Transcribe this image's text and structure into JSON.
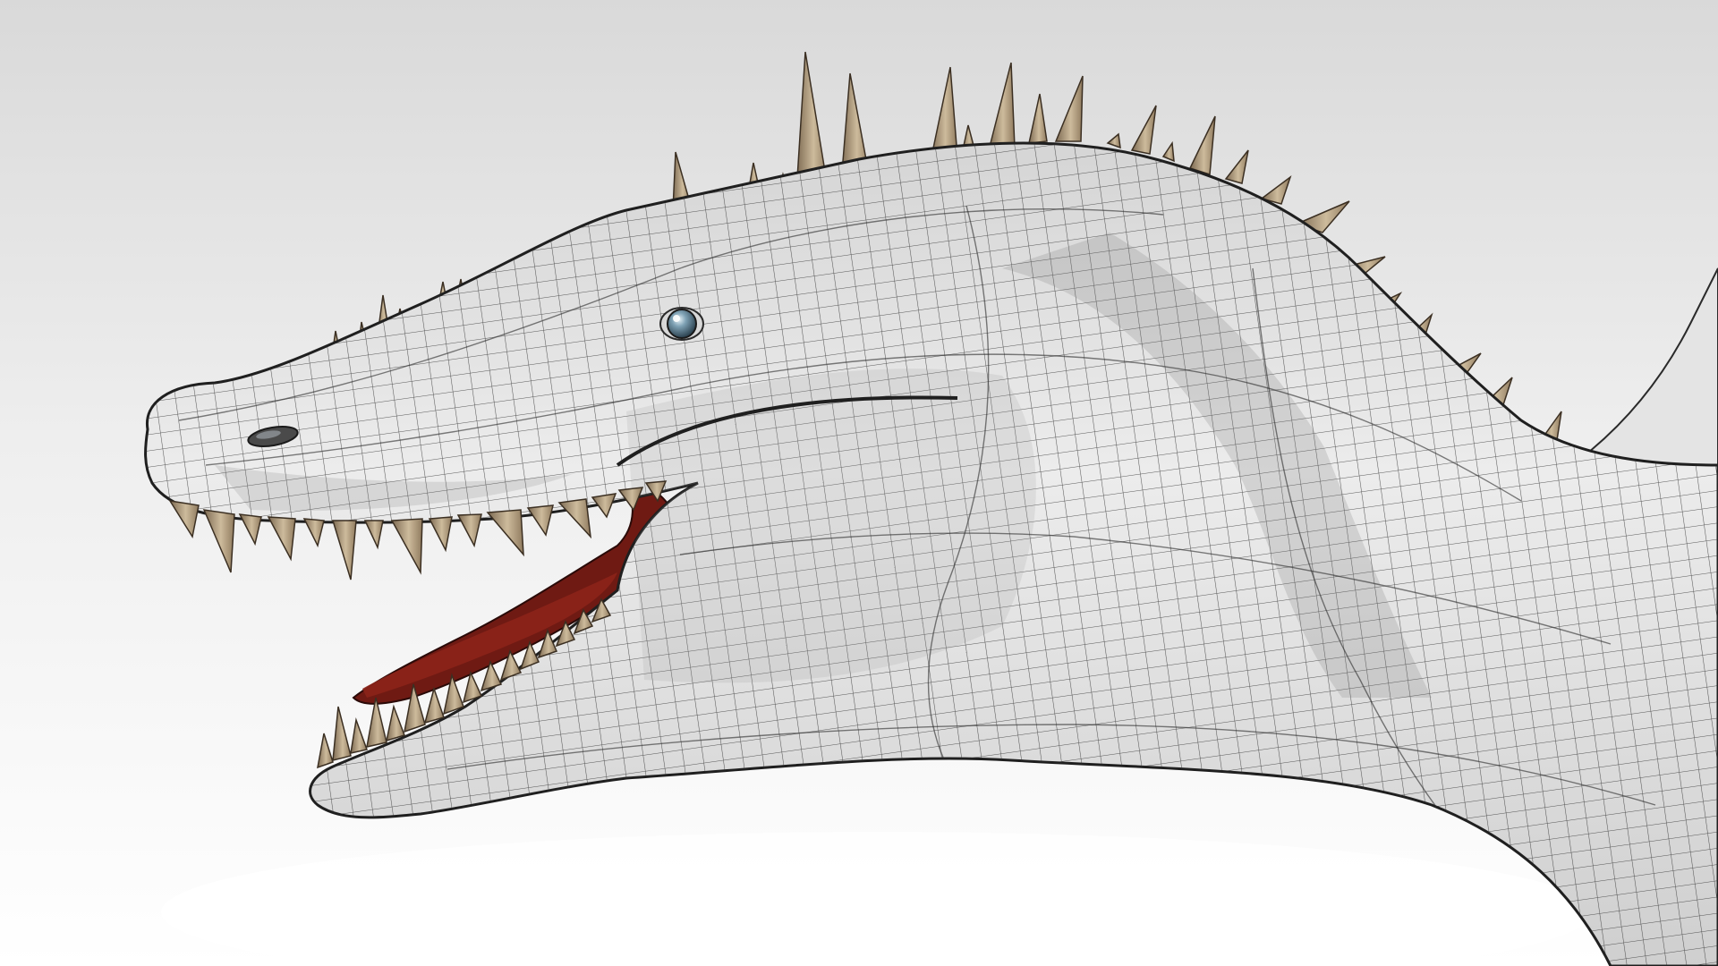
{
  "scene": {
    "subject": "dinosaur-head-wireframe-render",
    "colors": {
      "background_top": "#dcdcdc",
      "background_bottom": "#ffffff",
      "skin": "#e8e8e8",
      "skin_shadow": "#b9b9b9",
      "wire": "#2a2a2a",
      "teeth": "#c9b79a",
      "teeth_shadow": "#8a7458",
      "mouth": "#7a1c15",
      "eye": "#5b7f95"
    }
  }
}
